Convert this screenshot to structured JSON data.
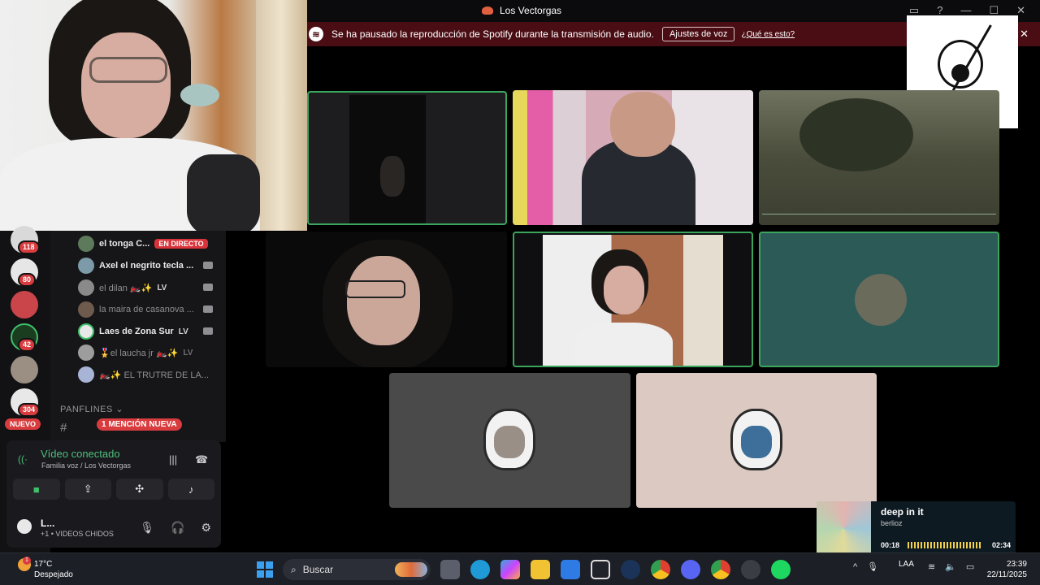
{
  "window": {
    "title": "Los Vectorgas"
  },
  "notice": {
    "message": "Se ha pausado la reproducción de Spotify durante la transmisión de audio.",
    "button_label": "Ajustes de voz",
    "link_label": "¿Qué es esto?"
  },
  "servers": {
    "badges": [
      "118",
      "80",
      "42",
      "304"
    ],
    "new_label": "NUEVO"
  },
  "voice_members": [
    {
      "name": "el tonga C...",
      "status": "EN DIRECTO"
    },
    {
      "name": "Axel el negrito tecla ...",
      "status": ""
    },
    {
      "name": "el dilan 🏍️✨",
      "status": "LV"
    },
    {
      "name": "la maira de casanova ...",
      "status": ""
    },
    {
      "name": "Laes de Zona Sur",
      "status": "LV"
    },
    {
      "name": "🎖️el laucha jr 🏍️✨",
      "status": "LV"
    },
    {
      "name": "🏍️✨ EL TRUTRE DE LA...",
      "status": ""
    }
  ],
  "category": {
    "label": "PANFLINES",
    "mention_label": "1 MENCIÓN NUEVA"
  },
  "voice_panel": {
    "status": "Vídeo conectado",
    "location": "Familia voz / Los Vectorgas",
    "user_name": "L...",
    "user_status": "+1 • VIDEOS CHIDOS"
  },
  "spotify_player": {
    "song": "deep in it",
    "artist": "berlioz",
    "elapsed": "00:18",
    "total": "02:34",
    "progress_fraction": 0.12
  },
  "taskbar": {
    "temperature": "17°C",
    "condition": "Despejado",
    "weather_badge": "1",
    "search_placeholder": "Buscar",
    "language": "LAA",
    "time": "23:39",
    "date": "22/11/2025"
  },
  "colors": {
    "speaking_border": "#3ba55d",
    "notice_bg": "#4a0d14",
    "live_badge": "#d8333a",
    "connected_green": "#4ac07b"
  }
}
